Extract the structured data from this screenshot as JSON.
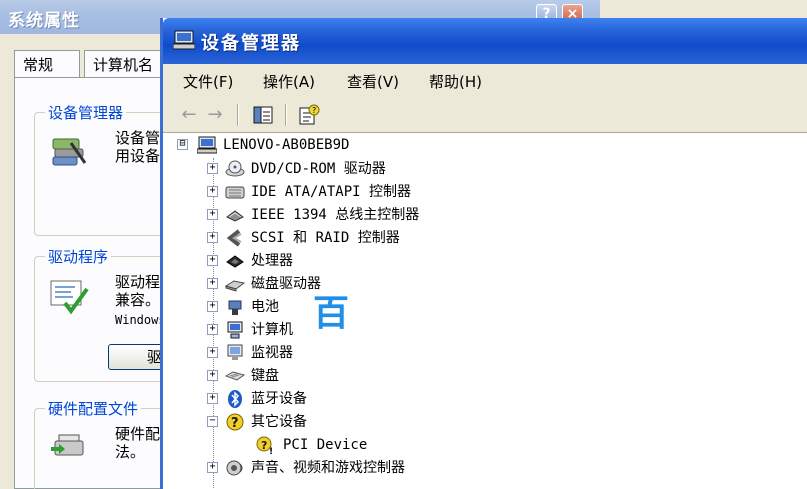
{
  "system_properties": {
    "title": "系统属性",
    "tabs": [
      "常规",
      "计算机名"
    ],
    "groups": {
      "device_manager": {
        "title": "设备管理器",
        "text": [
          "设备管",
          "用设备"
        ]
      },
      "driver": {
        "title": "驱动程序",
        "text": [
          "驱动程",
          "兼容。",
          "Windows"
        ],
        "button_label": "驱"
      },
      "hardware_profile": {
        "title": "硬件配置文件",
        "text": [
          "硬件配",
          "法。"
        ]
      }
    },
    "help_label": "?",
    "close_label": "×"
  },
  "device_manager": {
    "title": "设备管理器",
    "menu": {
      "file": "文件(F)",
      "action": "操作(A)",
      "view": "查看(V)",
      "help": "帮助(H)"
    },
    "toolbar": {
      "back": "←",
      "forward": "→"
    },
    "tree": {
      "root": "LENOVO-AB0BEB9D",
      "root_expander": "⊟",
      "categories": [
        {
          "label": "DVD/CD-ROM 驱动器",
          "icon": "cdrom-icon",
          "expander": "+"
        },
        {
          "label": "IDE ATA/ATAPI 控制器",
          "icon": "ide-controller-icon",
          "expander": "+"
        },
        {
          "label": "IEEE 1394 总线主控制器",
          "icon": "ieee1394-icon",
          "expander": "+"
        },
        {
          "label": "SCSI 和 RAID 控制器",
          "icon": "scsi-icon",
          "expander": "+"
        },
        {
          "label": "处理器",
          "icon": "processor-icon",
          "expander": "+"
        },
        {
          "label": "磁盘驱动器",
          "icon": "disk-drive-icon",
          "expander": "+"
        },
        {
          "label": "电池",
          "icon": "battery-icon",
          "expander": "+"
        },
        {
          "label": "计算机",
          "icon": "computer-icon",
          "expander": "+"
        },
        {
          "label": "监视器",
          "icon": "monitor-icon",
          "expander": "+"
        },
        {
          "label": "键盘",
          "icon": "keyboard-icon",
          "expander": "+"
        },
        {
          "label": "蓝牙设备",
          "icon": "bluetooth-icon",
          "expander": "+"
        },
        {
          "label": "其它设备",
          "icon": "unknown-device-icon",
          "expander": "−"
        },
        {
          "label": "声音、视频和游戏控制器",
          "icon": "sound-icon",
          "expander": "+"
        }
      ],
      "child_device": {
        "label": "PCI Device",
        "icon": "warning-device-icon",
        "warning_mark": "!"
      },
      "unknown_mark": "?"
    },
    "watermark": "百"
  }
}
